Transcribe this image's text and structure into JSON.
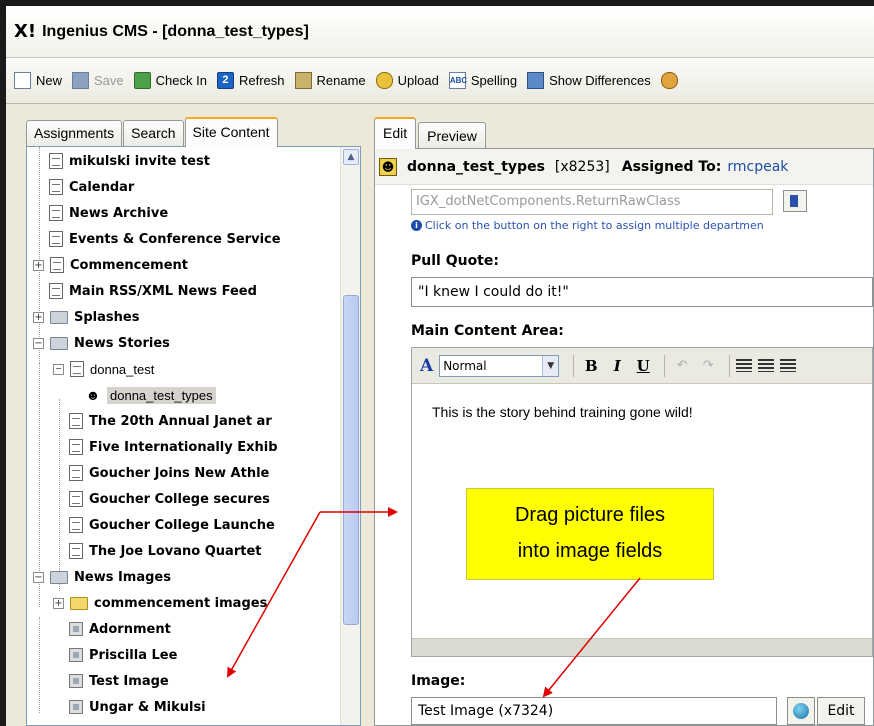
{
  "window": {
    "title": "Ingenius CMS - [donna_test_types]",
    "logo": "X!"
  },
  "toolbar": {
    "buttons": [
      {
        "label": "New",
        "icon": "new-page-icon"
      },
      {
        "label": "Save",
        "icon": "save-disk-icon",
        "disabled": true
      },
      {
        "label": "Check In",
        "icon": "check-in-icon"
      },
      {
        "label": "Refresh",
        "icon": "refresh-icon"
      },
      {
        "label": "Rename",
        "icon": "rename-icon"
      },
      {
        "label": "Upload",
        "icon": "upload-icon"
      },
      {
        "label": "Spelling",
        "icon": "spelling-icon"
      },
      {
        "label": "Show Differences",
        "icon": "show-differences-icon"
      }
    ]
  },
  "left_tabs": [
    "Assignments",
    "Search",
    "Site Content"
  ],
  "left_active_tab": "Site Content",
  "tree": [
    {
      "label": "mikulski invite test",
      "icon": "page"
    },
    {
      "label": "Calendar",
      "icon": "page"
    },
    {
      "label": "News Archive",
      "icon": "archive"
    },
    {
      "label": "Events & Conference Service",
      "icon": "page"
    },
    {
      "label": "Commencement",
      "icon": "page",
      "expander": "+"
    },
    {
      "label": "Main RSS/XML News Feed",
      "icon": "page"
    },
    {
      "label": "Splashes",
      "icon": "folder",
      "expander": "+"
    },
    {
      "label": "News Stories",
      "icon": "folder-open",
      "expander": "−"
    },
    {
      "label": "donna_test",
      "icon": "page",
      "expander": "−"
    },
    {
      "label": "donna_test_types",
      "icon": "assign",
      "selected": true
    },
    {
      "label": "The 20th Annual Janet ar",
      "icon": "page"
    },
    {
      "label": "Five Internationally Exhib",
      "icon": "page"
    },
    {
      "label": "Goucher Joins New Athle",
      "icon": "page"
    },
    {
      "label": "Goucher College secures",
      "icon": "page"
    },
    {
      "label": "Goucher College Launche",
      "icon": "page"
    },
    {
      "label": "The Joe Lovano Quartet",
      "icon": "page"
    },
    {
      "label": "News Images",
      "icon": "folder-open",
      "expander": "−"
    },
    {
      "label": "commencement images",
      "icon": "folder-yellow",
      "expander": "+"
    },
    {
      "label": "Adornment",
      "icon": "image"
    },
    {
      "label": "Priscilla Lee",
      "icon": "image"
    },
    {
      "label": "Test Image",
      "icon": "image"
    },
    {
      "label": "Ungar & Mikulsi",
      "icon": "image"
    }
  ],
  "right_tabs": [
    "Edit",
    "Preview"
  ],
  "right_active_tab": "Edit",
  "doc": {
    "name": "donna_test_types",
    "id": "[x8253]",
    "assigned_label": "Assigned To:",
    "assigned_value": "rmcpeak"
  },
  "component_field": "IGX_dotNetComponents.ReturnRawClass",
  "dept_hint": "Click on the button on the right to assign multiple departmen",
  "pull_quote": {
    "label": "Pull Quote:",
    "value": "\"I knew I could do it!\""
  },
  "main_content": {
    "label": "Main Content Area:",
    "style_value": "Normal",
    "body": "This is the story behind training gone wild!"
  },
  "image_field": {
    "label": "Image:",
    "value": "Test Image (x7324)",
    "edit_label": "Edit"
  },
  "callout": {
    "line1": "Drag picture files",
    "line2": "into image fields",
    "color": "#ffff00"
  },
  "arrow_color": "#e00000"
}
